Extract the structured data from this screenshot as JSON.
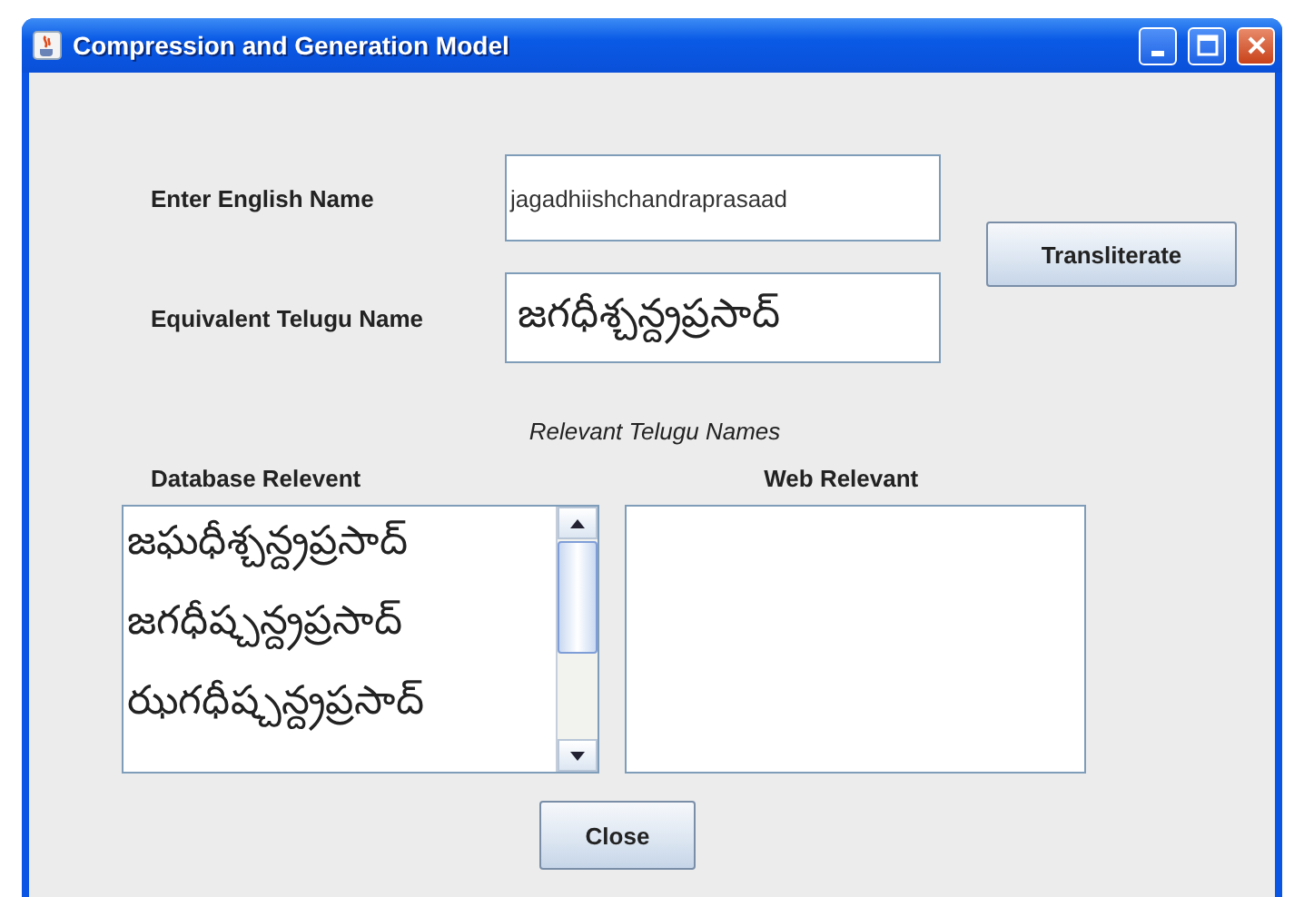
{
  "window": {
    "title": "Compression and Generation Model"
  },
  "form": {
    "english_label": "Enter English Name",
    "english_value": "jagadhiishchandraprasaad",
    "telugu_label": "Equivalent Telugu Name",
    "telugu_value": "జగధీశ్చన్ద్రప్రసాద్",
    "transliterate_button": "Transliterate"
  },
  "results": {
    "heading": "Relevant Telugu Names",
    "database_label": "Database Relevent",
    "web_label": "Web Relevant",
    "database_items": [
      "జఘధీశ్చన్ద్రప్రసాద్",
      "జగధీష్చన్ద్రప్రసాద్",
      "ఝగధీష్చన్ద్రప్రసాద్"
    ]
  },
  "buttons": {
    "close": "Close"
  }
}
